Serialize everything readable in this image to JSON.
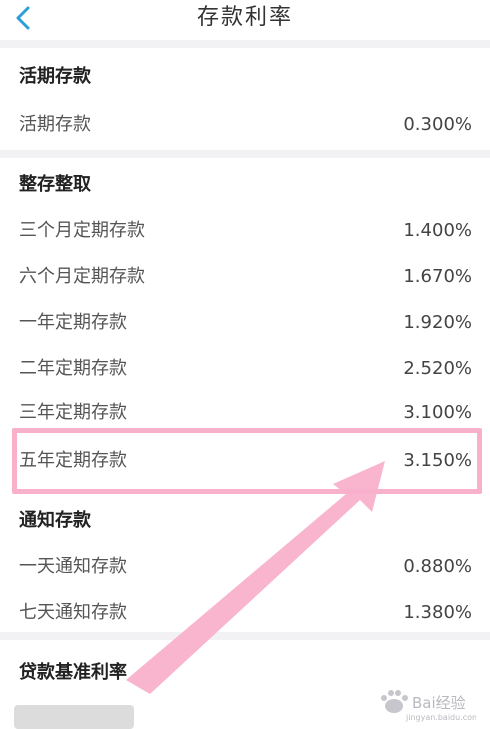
{
  "header": {
    "title": "存款利率",
    "back_icon": "chevron-left-icon"
  },
  "colors": {
    "accent": "#2a9fd8",
    "highlight": "#f9b0cb",
    "background": "#f2f2f4"
  },
  "sections": {
    "demand": {
      "title": "活期存款",
      "rows": [
        {
          "label": "活期存款",
          "value": "0.300%"
        }
      ]
    },
    "fixed": {
      "title": "整存整取",
      "rows": [
        {
          "label": "三个月定期存款",
          "value": "1.400%"
        },
        {
          "label": "六个月定期存款",
          "value": "1.670%"
        },
        {
          "label": "一年定期存款",
          "value": "1.920%"
        },
        {
          "label": "二年定期存款",
          "value": "2.520%"
        },
        {
          "label": "三年定期存款",
          "value": "3.100%"
        },
        {
          "label": "五年定期存款",
          "value": "3.150%"
        }
      ]
    },
    "notice": {
      "title": "通知存款",
      "rows": [
        {
          "label": "一天通知存款",
          "value": "0.880%"
        },
        {
          "label": "七天通知存款",
          "value": "1.380%"
        }
      ]
    },
    "loan": {
      "title": "贷款基准利率"
    }
  },
  "watermark": {
    "text": "Bai经验",
    "subtext": "jingyan.baidu.com"
  }
}
